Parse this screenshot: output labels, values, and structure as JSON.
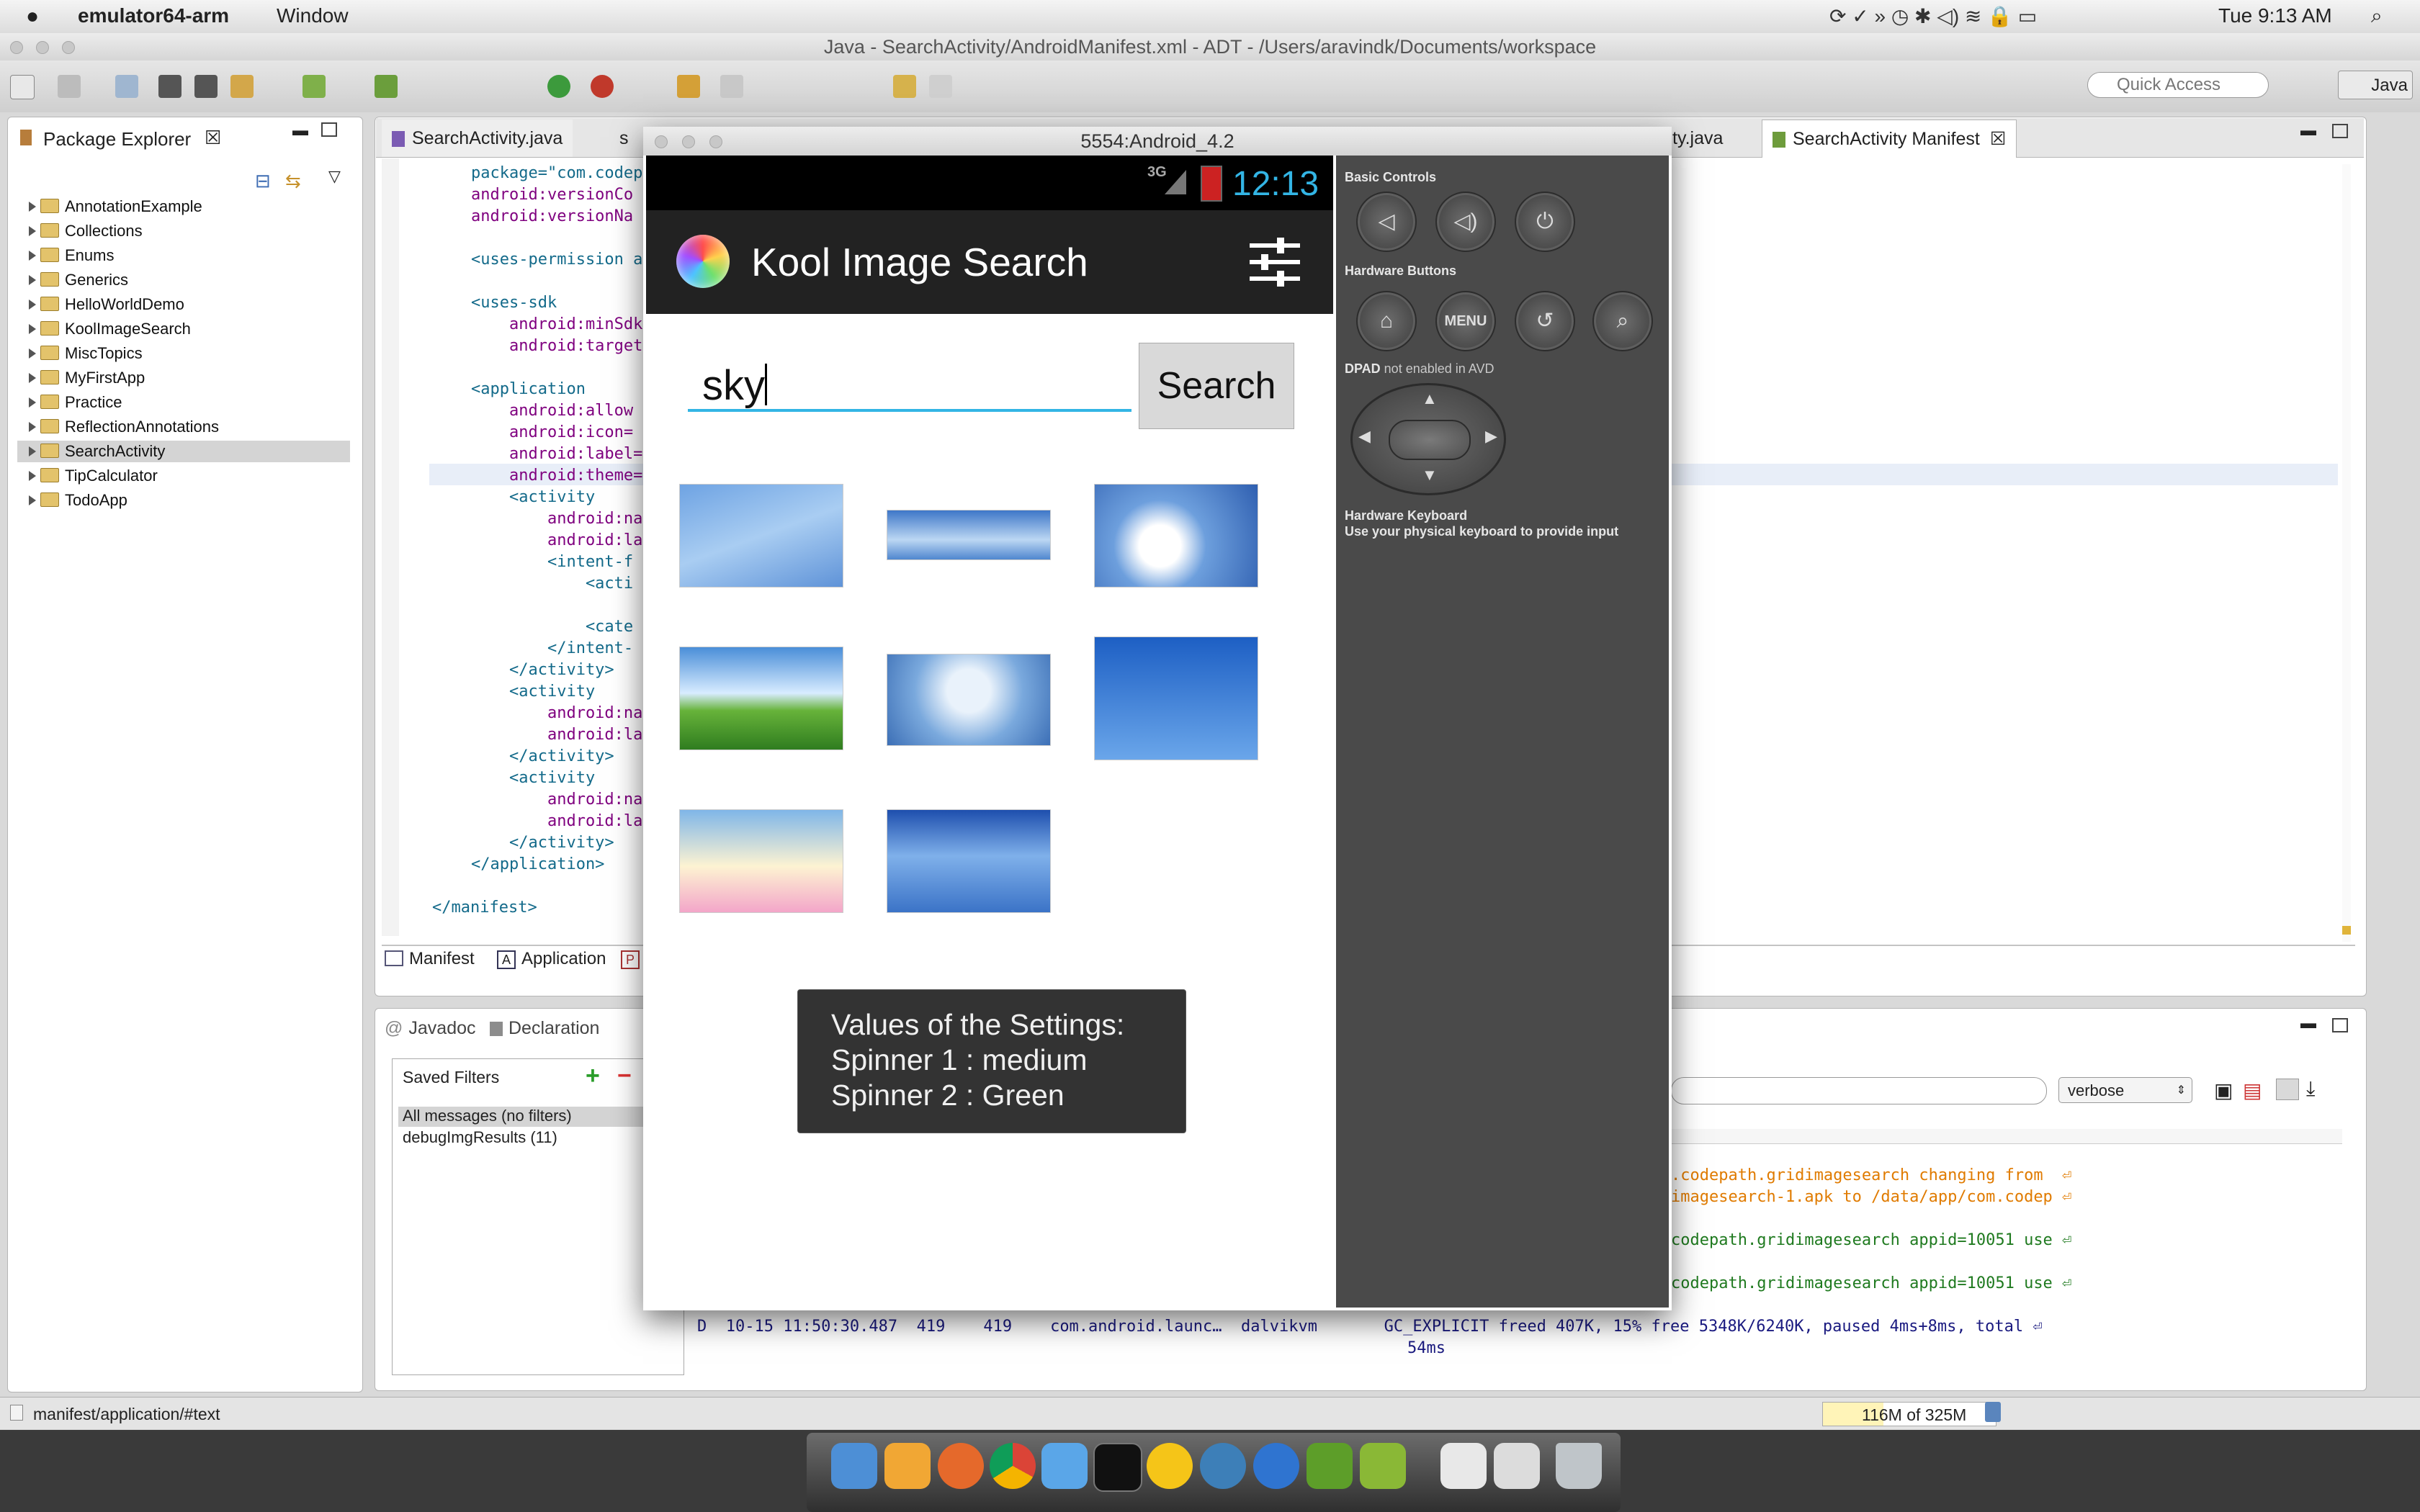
{
  "menubar": {
    "app_name": "emulator64-arm",
    "menu_window": "Window",
    "clock": "Tue 9:13 AM"
  },
  "window": {
    "title": "Java - SearchActivity/AndroidManifest.xml - ADT - /Users/aravindk/Documents/workspace",
    "quick_access_placeholder": "Quick Access",
    "perspective": "Java"
  },
  "package_explorer": {
    "title": "Package Explorer",
    "projects": [
      "AnnotationExample",
      "Collections",
      "Enums",
      "Generics",
      "HelloWorldDemo",
      "KoolImageSearch",
      "MiscTopics",
      "MyFirstApp",
      "Practice",
      "ReflectionAnnotations",
      "SearchActivity",
      "TipCalculator",
      "TodoApp"
    ],
    "selected": "SearchActivity"
  },
  "editor": {
    "tabs": [
      "SearchActivity.java",
      "s",
      "ty.java",
      "SearchActivity Manifest"
    ],
    "code_lines": [
      "package=\"com.codep",
      "android:versionCo",
      "android:versionNa",
      "",
      "<uses-permission a",
      "",
      "<uses-sdk",
      "    android:minSdk",
      "    android:target",
      "",
      "<application",
      "    android:allow",
      "    android:icon=",
      "    android:label=",
      "    android:theme=",
      "    <activity",
      "        android:na",
      "        android:la",
      "        <intent-f",
      "            <acti",
      "",
      "            <cate",
      "        </intent-",
      "    </activity>",
      "    <activity",
      "        android:na",
      "        android:la",
      "    </activity>",
      "    <activity",
      "        android:na",
      "        android:la",
      "    </activity>",
      "</application>",
      "",
      "</manifest>"
    ],
    "bottom_tabs": [
      "Manifest",
      "Application",
      "P"
    ]
  },
  "bottom_panel": {
    "tabs": [
      "Javadoc",
      "Declaration"
    ],
    "saved_filters_title": "Saved Filters",
    "filters": [
      "All messages (no filters)",
      "debugImgResults (11)"
    ],
    "log_level": "verbose",
    "log_lines": [
      {
        "text": ".codepath.gridimagesearch changing from  ⏎",
        "color": "#e07b00"
      },
      {
        "text": "imagesearch-1.apk to /data/app/com.codep ⏎",
        "color": "#e07b00"
      },
      {
        "text": "codepath.gridimagesearch appid=10051 use ⏎",
        "color": "#1f7a1f"
      },
      {
        "text": "codepath.gridimagesearch appid=10051 use ⏎",
        "color": "#1f7a1f"
      },
      {
        "text": "D  10-15 11:50:30.487  419    419    com.android.launc…  dalvikvm       GC_EXPLICIT freed 407K, 15% free 5348K/6240K, paused 4ms+8ms, total ⏎",
        "color": "#1a1a80"
      },
      {
        "text": "54ms",
        "color": "#1a1a80"
      }
    ]
  },
  "statusbar": {
    "path": "manifest/application/#text",
    "heap": "116M of 325M"
  },
  "emulator": {
    "title": "5554:Android_4.2",
    "network": "3G",
    "time": "12:13",
    "app_title": "Kool Image Search",
    "search_value": "sky",
    "search_button": "Search",
    "toast_lines": [
      "Values of the Settings:",
      "Spinner 1 : medium",
      "Spinner 2 : Green"
    ],
    "controls": {
      "basic": "Basic Controls",
      "hardware": "Hardware Buttons",
      "dpad_bold": "DPAD",
      "dpad_rest": " not enabled in AVD",
      "keyboard_title": "Hardware Keyboard",
      "keyboard_desc": "Use your physical keyboard to provide input",
      "menu_label": "MENU"
    }
  },
  "colors": {
    "android_blue": "#33b5e5",
    "selection": "#d4d4d4"
  }
}
